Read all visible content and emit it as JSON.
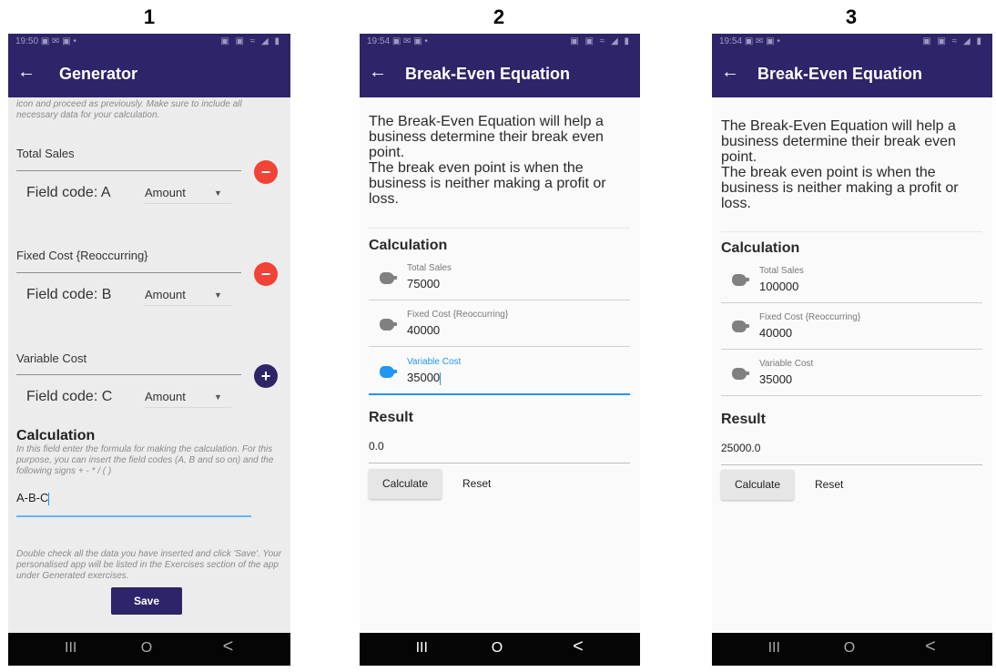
{
  "panel_numbers": [
    "1",
    "2",
    "3"
  ],
  "status_time_1": "19:50",
  "status_time_2": "19:54",
  "status_time_3": "19:54",
  "status_icons_left": "▣ ✉ ▣ •",
  "status_icons_right": "▣ ▣ ≈ ◢ ▮",
  "generator": {
    "title": "Generator",
    "intro_hint": "icon and proceed as previously. Make sure to include all necessary data for your calculation.",
    "fields": [
      {
        "label": "Total Sales",
        "code": "Field code: A",
        "type": "Amount",
        "action": "−"
      },
      {
        "label": "Fixed Cost {Reoccurring}",
        "code": "Field code: B",
        "type": "Amount",
        "action": "−"
      },
      {
        "label": "Variable Cost",
        "code": "Field code: C",
        "type": "Amount",
        "action": "+"
      }
    ],
    "calculation_heading": "Calculation",
    "calculation_hint": "In this field enter the formula for making the calculation. For this purpose, you can insert the field codes (A, B and so on) and the following signs + - * / ( )",
    "formula": "A-B-C",
    "footer_hint": "Double check all the data you have inserted and click 'Save'. Your personalised app will be listed in the Exercises section of the app under Generated exercises.",
    "save_label": "Save"
  },
  "equation": {
    "title": "Break-Even Equation",
    "description_1": "The Break-Even Equation will help a business determine their break even point.",
    "description_2": "The break even point is when the business is neither making a profit or loss.",
    "calculation_heading": "Calculation",
    "result_heading": "Result",
    "calculate_label": "Calculate",
    "reset_label": "Reset",
    "labels": [
      "Total Sales",
      "Fixed Cost {Reoccurring}",
      "Variable Cost"
    ],
    "values_2": [
      "75000",
      "40000",
      "35000"
    ],
    "result_2": "0.0",
    "values_3": [
      "100000",
      "40000",
      "35000"
    ],
    "result_3": "25000.0"
  },
  "nav": {
    "recent": "III",
    "home": "O",
    "back": "<"
  },
  "back_arrow": "←",
  "dropdown_caret": "▼",
  "accent_color": "#2e2469",
  "focus_color": "#2196f3",
  "remove_color": "#f14336"
}
